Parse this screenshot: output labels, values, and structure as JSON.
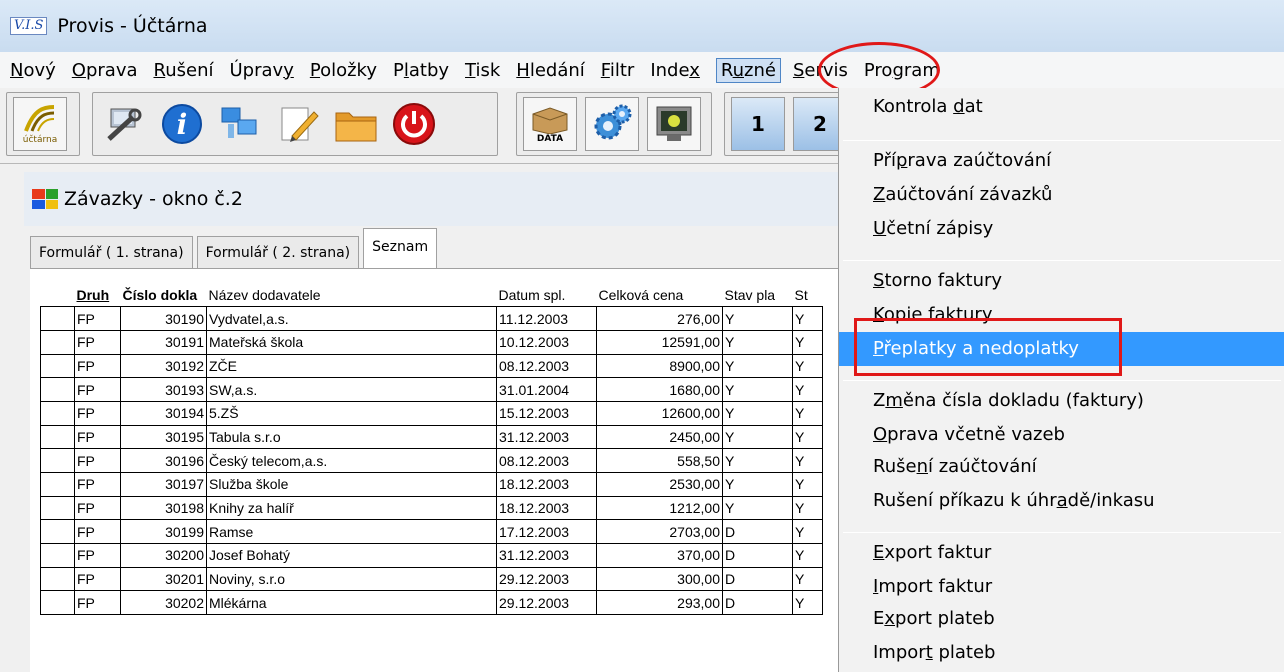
{
  "window": {
    "app_logo": "V.I.S",
    "title": "Provis - Účtárna"
  },
  "menubar": [
    {
      "pre": "",
      "ul": "N",
      "post": "ový"
    },
    {
      "pre": "",
      "ul": "O",
      "post": "prava"
    },
    {
      "pre": "",
      "ul": "R",
      "post": "ušení"
    },
    {
      "pre": "Úprav",
      "ul": "y",
      "post": ""
    },
    {
      "pre": "",
      "ul": "P",
      "post": "oložky"
    },
    {
      "pre": "P",
      "ul": "l",
      "post": "atby"
    },
    {
      "pre": "",
      "ul": "T",
      "post": "isk"
    },
    {
      "pre": "",
      "ul": "H",
      "post": "ledání"
    },
    {
      "pre": "",
      "ul": "F",
      "post": "iltr"
    },
    {
      "pre": "Inde",
      "ul": "x",
      "post": ""
    },
    {
      "pre": "R",
      "ul": "u",
      "post": "zné"
    },
    {
      "pre": "",
      "ul": "S",
      "post": "ervis"
    },
    {
      "pre": "Pro",
      "ul": "g",
      "post": "ram"
    }
  ],
  "toolbar": {
    "logo_caption": "účtárna",
    "data_label": "DATA",
    "btn1": "1",
    "btn2": "2",
    "icons": [
      "ucetni-logo-icon",
      "tools-icon",
      "info-icon",
      "computers-icon",
      "edit-icon",
      "folder-icon",
      "power-icon",
      "data-box-icon",
      "settings-gears-icon",
      "monitor-icon"
    ]
  },
  "child_window": {
    "title": "Závazky - okno č.2"
  },
  "tabs": [
    "Formulář ( 1. strana)",
    "Formulář ( 2. strana)",
    "Seznam"
  ],
  "grid": {
    "columns": [
      "Druh",
      "Číslo dokla",
      "Název dodavatele",
      "Datum spl.",
      "Celková cena",
      "Stav pla",
      "St"
    ],
    "rows": [
      {
        "druh": "FP",
        "cislo": "30190",
        "nazev": "Vydvatel,a.s.",
        "datum": "11.12.2003",
        "cena": "276,00",
        "stav": "Y",
        "st": "Y"
      },
      {
        "druh": "FP",
        "cislo": "30191",
        "nazev": "Mateřská škola",
        "datum": "10.12.2003",
        "cena": "12591,00",
        "stav": "Y",
        "st": "Y"
      },
      {
        "druh": "FP",
        "cislo": "30192",
        "nazev": "ZČE",
        "datum": "08.12.2003",
        "cena": "8900,00",
        "stav": "Y",
        "st": "Y"
      },
      {
        "druh": "FP",
        "cislo": "30193",
        "nazev": "SW,a.s.",
        "datum": "31.01.2004",
        "cena": "1680,00",
        "stav": "Y",
        "st": "Y"
      },
      {
        "druh": "FP",
        "cislo": "30194",
        "nazev": "5.ZŠ",
        "datum": "15.12.2003",
        "cena": "12600,00",
        "stav": "Y",
        "st": "Y"
      },
      {
        "druh": "FP",
        "cislo": "30195",
        "nazev": "Tabula s.r.o",
        "datum": "31.12.2003",
        "cena": "2450,00",
        "stav": "Y",
        "st": "Y"
      },
      {
        "druh": "FP",
        "cislo": "30196",
        "nazev": "Český telecom,a.s.",
        "datum": "08.12.2003",
        "cena": "558,50",
        "stav": "Y",
        "st": "Y"
      },
      {
        "druh": "FP",
        "cislo": "30197",
        "nazev": "Služba škole",
        "datum": "18.12.2003",
        "cena": "2530,00",
        "stav": "Y",
        "st": "Y"
      },
      {
        "druh": "FP",
        "cislo": "30198",
        "nazev": "Knihy za halíř",
        "datum": "18.12.2003",
        "cena": "1212,00",
        "stav": "Y",
        "st": "Y"
      },
      {
        "druh": "FP",
        "cislo": "30199",
        "nazev": "Ramse",
        "datum": "17.12.2003",
        "cena": "2703,00",
        "stav": "D",
        "st": "Y"
      },
      {
        "druh": "FP",
        "cislo": "30200",
        "nazev": "Josef Bohatý",
        "datum": "31.12.2003",
        "cena": "370,00",
        "stav": "D",
        "st": "Y"
      },
      {
        "druh": "FP",
        "cislo": "30201",
        "nazev": "Noviny, s.r.o",
        "datum": "29.12.2003",
        "cena": "300,00",
        "stav": "D",
        "st": "Y"
      },
      {
        "druh": "FP",
        "cislo": "30202",
        "nazev": "Mlékárna",
        "datum": "29.12.2003",
        "cena": "293,00",
        "stav": "D",
        "st": "Y"
      }
    ]
  },
  "dropdown": {
    "highlight_color": "#3399ff",
    "items": [
      {
        "pre": "Kontrola ",
        "ul": "d",
        "post": "at",
        "group": 0
      },
      {
        "pre": "Pří",
        "ul": "p",
        "post": "rava zaúčtování",
        "group": 1
      },
      {
        "pre": "",
        "ul": "Z",
        "post": "aúčtování závazků",
        "group": 1
      },
      {
        "pre": "",
        "ul": "U",
        "post": "četní zápisy",
        "group": 1
      },
      {
        "pre": "",
        "ul": "S",
        "post": "torno faktury",
        "group": 2
      },
      {
        "pre": "",
        "ul": "K",
        "post": "opie faktury",
        "group": 2
      },
      {
        "pre": "",
        "ul": "P",
        "post": "řeplatky a nedoplatky",
        "group": 2,
        "highlighted": true
      },
      {
        "pre": "Z",
        "ul": "m",
        "post": "ěna čísla dokladu (faktury)",
        "group": 3
      },
      {
        "pre": "",
        "ul": "O",
        "post": "prava včetně vazeb",
        "group": 3
      },
      {
        "pre": "Ruše",
        "ul": "n",
        "post": "í zaúčtování",
        "group": 3
      },
      {
        "pre": "Rušení příkazu k úhr",
        "ul": "a",
        "post": "dě/inkasu",
        "group": 3
      },
      {
        "pre": "",
        "ul": "E",
        "post": "xport faktur",
        "group": 4
      },
      {
        "pre": "",
        "ul": "I",
        "post": "mport faktur",
        "group": 4
      },
      {
        "pre": "E",
        "ul": "x",
        "post": "port plateb",
        "group": 4
      },
      {
        "pre": "Impor",
        "ul": "t",
        "post": " plateb",
        "group": 4
      }
    ]
  }
}
